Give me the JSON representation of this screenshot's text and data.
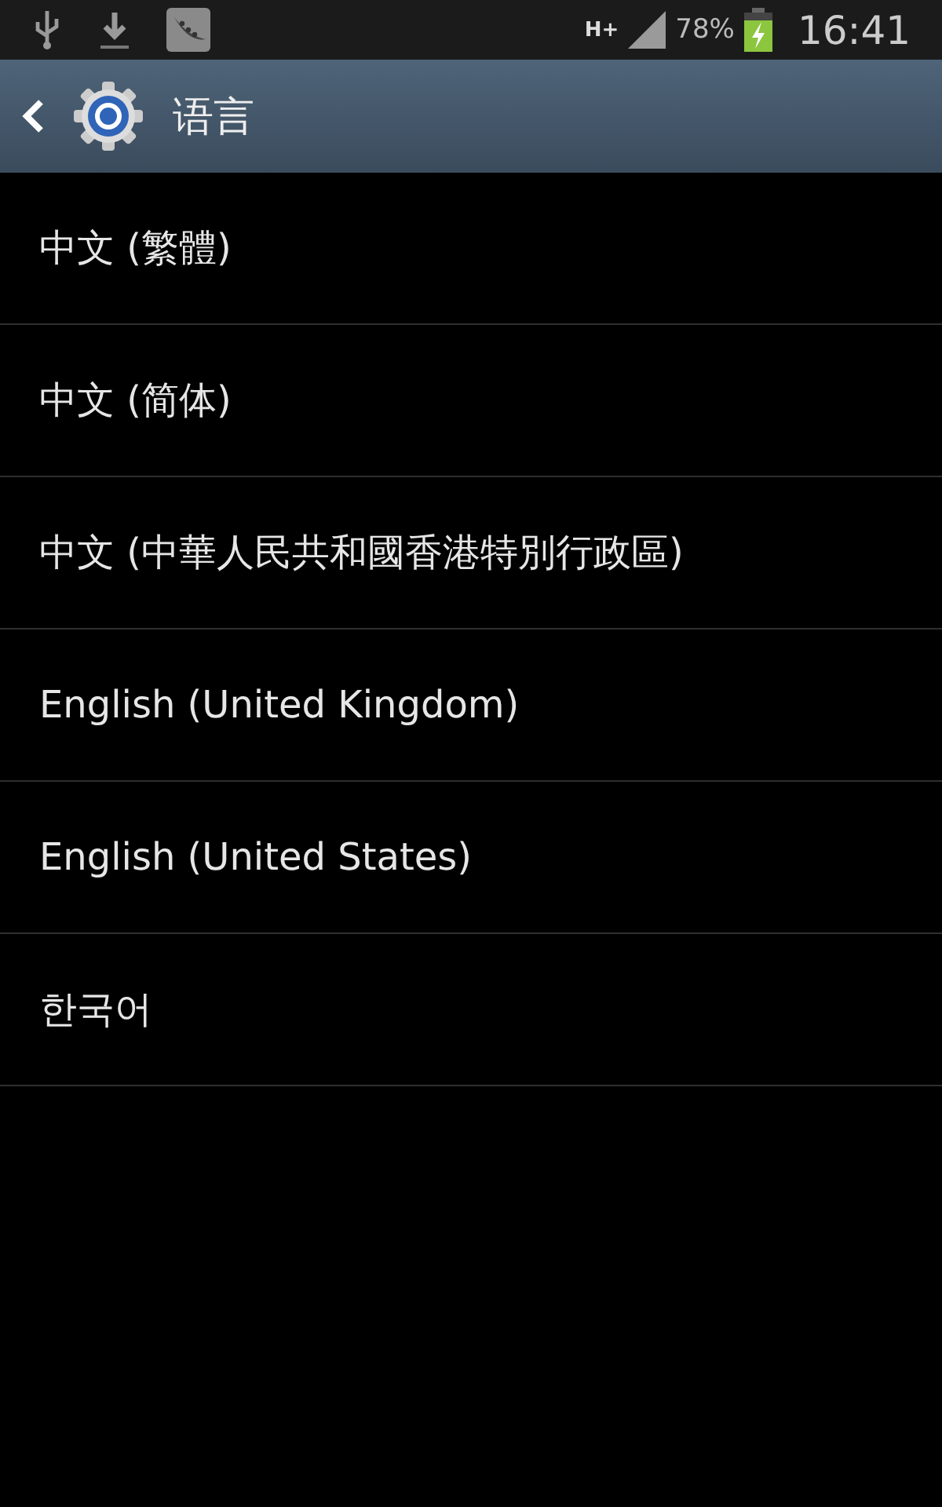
{
  "status_bar": {
    "network": "H+",
    "battery": "78%",
    "time": "16:41"
  },
  "header": {
    "title": "语言"
  },
  "languages": [
    {
      "label": "中文 (繁體)"
    },
    {
      "label": "中文 (简体)"
    },
    {
      "label": "中文 (中華人民共和國香港特別行政區)"
    },
    {
      "label": "English (United Kingdom)"
    },
    {
      "label": "English (United States)"
    },
    {
      "label": "한국어"
    }
  ]
}
